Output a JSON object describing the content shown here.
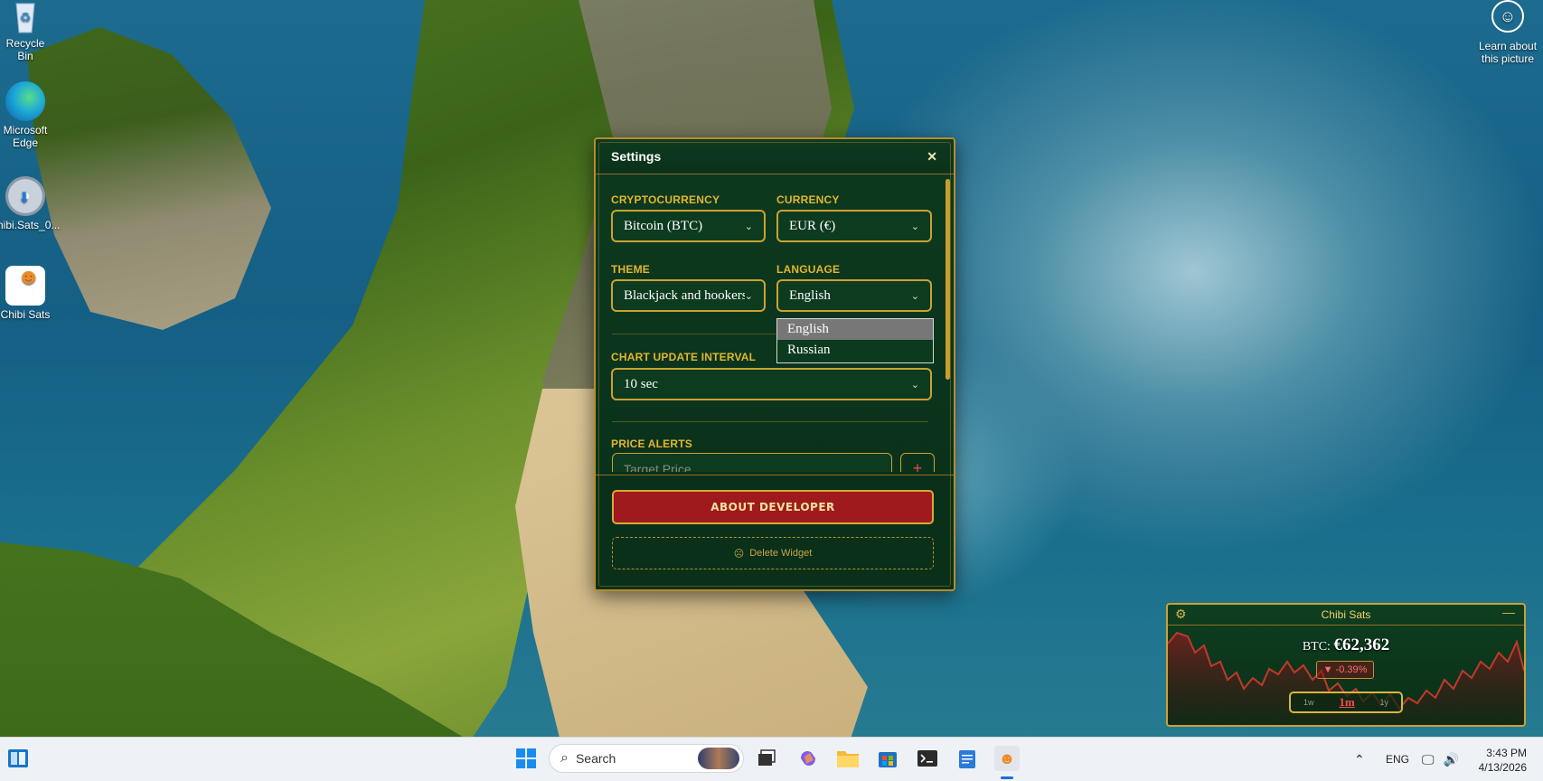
{
  "desktop": {
    "icons": [
      {
        "label": "Recycle Bin"
      },
      {
        "label": "Microsoft Edge"
      },
      {
        "label": "hibi.Sats_0..."
      },
      {
        "label": "Chibi Sats"
      }
    ],
    "learn_label": "Learn about this picture"
  },
  "settings": {
    "title": "Settings",
    "close_icon": "close-icon",
    "cryptocurrency_label": "CRYPTOCURRENCY",
    "cryptocurrency_value": "Bitcoin (BTC)",
    "currency_label": "CURRENCY",
    "currency_value": "EUR (€)",
    "theme_label": "THEME",
    "theme_value": "Blackjack and hookers",
    "language_label": "LANGUAGE",
    "language_value": "English",
    "language_options": [
      "English",
      "Russian"
    ],
    "interval_label": "CHART UPDATE INTERVAL",
    "interval_value": "10 sec",
    "alerts_label": "PRICE ALERTS",
    "target_placeholder": "Target Price",
    "add_symbol": "+",
    "about_button": "ABOUT DEVELOPER",
    "delete_button": "Delete Widget"
  },
  "widget": {
    "title": "Chibi Sats",
    "price_prefix": "BTC:",
    "price": "€62,362",
    "change": "▼ -0.39%",
    "tabs": [
      "1w",
      "1m",
      "1y"
    ],
    "active_tab": "1m",
    "minimize_symbol": "—",
    "accent": "#c9a233",
    "line_color": "#c0392b"
  },
  "taskbar": {
    "search_label": "Search",
    "language": "ENG",
    "time": "3:43 PM",
    "date": "4/13/2026"
  }
}
